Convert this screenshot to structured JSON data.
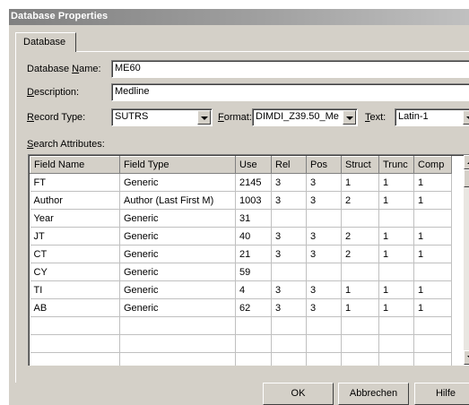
{
  "window": {
    "title": "Database Properties"
  },
  "tabs": [
    {
      "label": "Database"
    }
  ],
  "form": {
    "name_label_pre": "Database ",
    "name_label_ul": "N",
    "name_label_post": "ame:",
    "name_value": "ME60",
    "desc_label_ul": "D",
    "desc_label_post": "escription:",
    "desc_value": "Medline",
    "record_label_ul": "R",
    "record_label_post": "ecord Type:",
    "record_value": "SUTRS",
    "format_label_ul": "F",
    "format_label_post": "ormat:",
    "format_value": "DIMDI_Z39.50_Me",
    "text_label_ul": "T",
    "text_label_post": "ext:",
    "text_value": "Latin-1",
    "search_label_ul": "S",
    "search_label_post": "earch Attributes:"
  },
  "grid": {
    "columns": [
      "Field Name",
      "Field Type",
      "Use",
      "Rel",
      "Pos",
      "Struct",
      "Trunc",
      "Comp"
    ],
    "rows": [
      [
        "FT",
        "Generic",
        "2145",
        "3",
        "3",
        "1",
        "1",
        "1"
      ],
      [
        "Author",
        "Author (Last First M)",
        "1003",
        "3",
        "3",
        "2",
        "1",
        "1"
      ],
      [
        "Year",
        "Generic",
        "31",
        "",
        "",
        "",
        "",
        ""
      ],
      [
        "JT",
        "Generic",
        "40",
        "3",
        "3",
        "2",
        "1",
        "1"
      ],
      [
        "CT",
        "Generic",
        "21",
        "3",
        "3",
        "2",
        "1",
        "1"
      ],
      [
        "CY",
        "Generic",
        "59",
        "",
        "",
        "",
        "",
        ""
      ],
      [
        "TI",
        "Generic",
        "4",
        "3",
        "3",
        "1",
        "1",
        "1"
      ],
      [
        "AB",
        "Generic",
        "62",
        "3",
        "3",
        "1",
        "1",
        "1"
      ],
      [
        "",
        "",
        "",
        "",
        "",
        "",
        "",
        ""
      ],
      [
        "",
        "",
        "",
        "",
        "",
        "",
        "",
        ""
      ],
      [
        "",
        "",
        "",
        "",
        "",
        "",
        "",
        ""
      ]
    ]
  },
  "buttons": {
    "ok": "OK",
    "cancel": "Abbrechen",
    "help": "Hilfe"
  },
  "colors": {
    "dialog_bg": "#d4d0c8",
    "titlebar": "#808080",
    "field_bg": "#ffffff"
  }
}
